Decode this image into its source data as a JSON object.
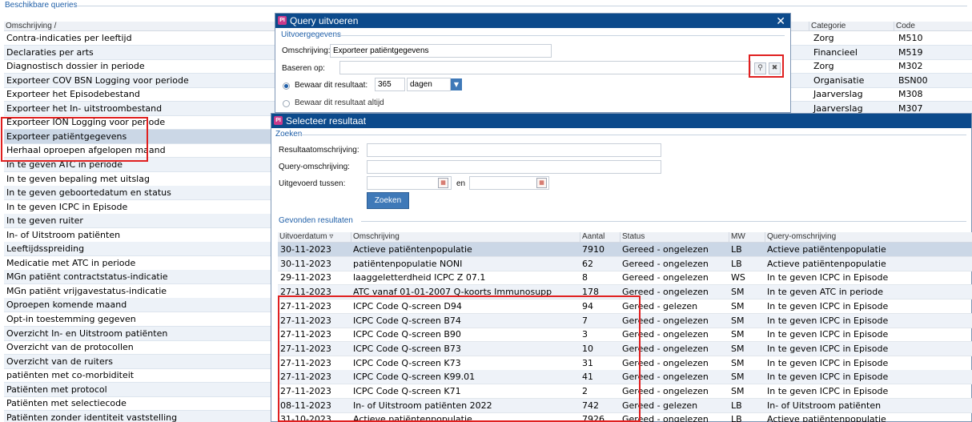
{
  "background": {
    "section_title": "Beschikbare queries",
    "columns": [
      "Omschrijving",
      "Categorie",
      "Code"
    ],
    "rows": [
      {
        "desc": "Contra-indicaties per leeftijd",
        "cat": "Zorg",
        "code": "M510"
      },
      {
        "desc": "Declaraties per arts",
        "cat": "Financieel",
        "code": "M519"
      },
      {
        "desc": "Diagnostisch dossier in periode",
        "cat": "Zorg",
        "code": "M302"
      },
      {
        "desc": "Exporteer COV BSN Logging voor periode",
        "cat": "Organisatie",
        "code": "BSN00"
      },
      {
        "desc": "Exporteer het Episodebestand",
        "cat": "Jaarverslag",
        "code": "M308"
      },
      {
        "desc": "Exporteer het In- uitstroombestand",
        "cat": "Jaarverslag",
        "code": "M307"
      },
      {
        "desc": "Exporteer ION Logging voor periode",
        "cat": "",
        "code": ""
      },
      {
        "desc": "Exporteer patiëntgegevens",
        "cat": "",
        "code": ""
      },
      {
        "desc": "Herhaal oproepen afgelopen maand",
        "cat": "",
        "code": ""
      },
      {
        "desc": "In te geven ATC in periode",
        "cat": "",
        "code": ""
      },
      {
        "desc": "In te geven bepaling met uitslag",
        "cat": "",
        "code": ""
      },
      {
        "desc": "In te geven geboortedatum en status",
        "cat": "",
        "code": ""
      },
      {
        "desc": "In te geven ICPC in Episode",
        "cat": "",
        "code": ""
      },
      {
        "desc": "In te geven ruiter",
        "cat": "",
        "code": ""
      },
      {
        "desc": "In- of Uitstroom patiënten",
        "cat": "",
        "code": ""
      },
      {
        "desc": "Leeftijdsspreiding",
        "cat": "",
        "code": ""
      },
      {
        "desc": "Medicatie met ATC in periode",
        "cat": "",
        "code": ""
      },
      {
        "desc": "MGn patiënt contractstatus-indicatie",
        "cat": "",
        "code": ""
      },
      {
        "desc": "MGn patiënt vrijgavestatus-indicatie",
        "cat": "",
        "code": ""
      },
      {
        "desc": "Oproepen komende maand",
        "cat": "",
        "code": ""
      },
      {
        "desc": "Opt-in toestemming gegeven",
        "cat": "",
        "code": ""
      },
      {
        "desc": "Overzicht In- en Uitstroom patiënten",
        "cat": "",
        "code": ""
      },
      {
        "desc": "Overzicht van de protocollen",
        "cat": "",
        "code": ""
      },
      {
        "desc": "Overzicht van de ruiters",
        "cat": "",
        "code": ""
      },
      {
        "desc": "patiënten met co-morbiditeit",
        "cat": "",
        "code": ""
      },
      {
        "desc": "Patiënten met protocol",
        "cat": "",
        "code": ""
      },
      {
        "desc": "Patiënten met selectiecode",
        "cat": "",
        "code": ""
      },
      {
        "desc": "Patiënten zonder identiteit vaststelling",
        "cat": "",
        "code": ""
      }
    ]
  },
  "dialog1": {
    "title": "Query uitvoeren",
    "close": "✕",
    "group": "Uitvoergegevens",
    "omschrijving_label": "Omschrijving:",
    "omschrijving_value": "Exporteer patiëntgegevens",
    "baseren_label": "Baseren op:",
    "baseren_value": "",
    "bewaar_label": "Bewaar dit resultaat:",
    "bewaar_value": "365",
    "unit_value": "dagen",
    "altijd_label": "Bewaar dit resultaat altijd"
  },
  "dialog2": {
    "title": "Selecteer resultaat",
    "search_group": "Zoeken",
    "result_desc_label": "Resultaatomschrijving:",
    "query_desc_label": "Query-omschrijving:",
    "between_label": "Uitgevoerd tussen:",
    "and_label": "en",
    "search_button": "Zoeken",
    "found_group": "Gevonden resultaten",
    "columns": [
      "Uitvoerdatum",
      "Omschrijving",
      "Aantal",
      "Status",
      "MW",
      "Query-omschrijving"
    ],
    "rows": [
      [
        "30-11-2023",
        "Actieve patiëntenpopulatie",
        "7910",
        "Gereed - ongelezen",
        "LB",
        "Actieve patiëntenpopulatie"
      ],
      [
        "30-11-2023",
        "patiëntenpopulatie NONI",
        "62",
        "Gereed - ongelezen",
        "LB",
        "Actieve patiëntenpopulatie"
      ],
      [
        "29-11-2023",
        "laaggeletterdheid ICPC Z 07.1",
        "8",
        "Gereed - ongelezen",
        "WS",
        "In te geven ICPC in Episode"
      ],
      [
        "27-11-2023",
        "ATC vanaf 01-01-2007 Q-koorts Immunosupp",
        "178",
        "Gereed - ongelezen",
        "SM",
        "In te geven ATC in periode"
      ],
      [
        "27-11-2023",
        "ICPC Code Q-screen D94",
        "94",
        "Gereed - gelezen",
        "SM",
        "In te geven ICPC in Episode"
      ],
      [
        "27-11-2023",
        "ICPC Code Q-screen B74",
        "7",
        "Gereed - ongelezen",
        "SM",
        "In te geven ICPC in Episode"
      ],
      [
        "27-11-2023",
        "ICPC Code Q-screen B90",
        "3",
        "Gereed - ongelezen",
        "SM",
        "In te geven ICPC in Episode"
      ],
      [
        "27-11-2023",
        "ICPC Code Q-screen B73",
        "10",
        "Gereed - ongelezen",
        "SM",
        "In te geven ICPC in Episode"
      ],
      [
        "27-11-2023",
        "ICPC Code Q-screen K73",
        "31",
        "Gereed - ongelezen",
        "SM",
        "In te geven ICPC in Episode"
      ],
      [
        "27-11-2023",
        "ICPC Code Q-screen K99.01",
        "41",
        "Gereed - ongelezen",
        "SM",
        "In te geven ICPC in Episode"
      ],
      [
        "27-11-2023",
        "ICPC Code Q-screen K71",
        "2",
        "Gereed - ongelezen",
        "SM",
        "In te geven ICPC in Episode"
      ],
      [
        "08-11-2023",
        "In- of Uitstroom patiënten 2022",
        "742",
        "Gereed - gelezen",
        "LB",
        "In- of Uitstroom patiënten"
      ],
      [
        "31-10-2023",
        "Actieve patiëntenpopulatie",
        "7926",
        "Gereed - ongelezen",
        "LB",
        "Actieve patiëntenpopulatie"
      ]
    ]
  },
  "colors": {
    "accent": "#0c4a8b",
    "highlight": "#e02020",
    "selected_row": "#cbd7e6"
  }
}
